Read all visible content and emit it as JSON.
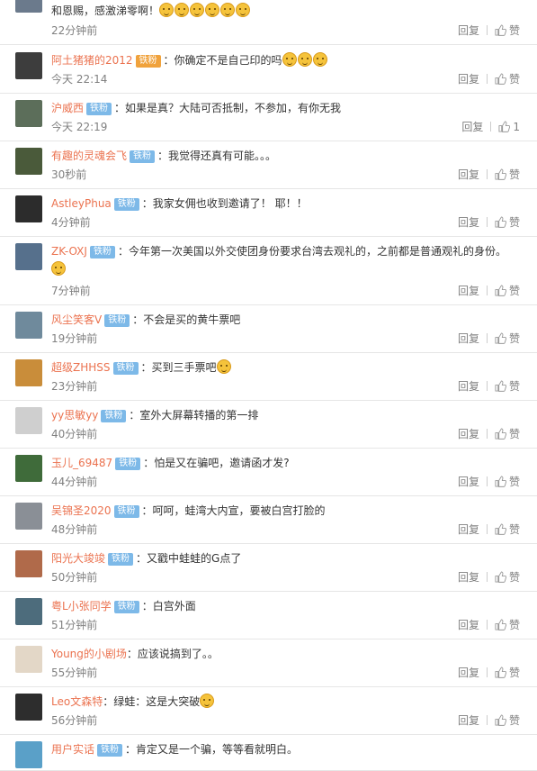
{
  "comments": [
    {
      "user": "",
      "badge": "",
      "text": "和恩赐，感激涕零啊！",
      "emojis": 6,
      "time": "22分钟前",
      "like": "赞",
      "reply": "回复"
    },
    {
      "user": "阿土猪猪的2012",
      "badge": "铁粉",
      "text": "：你确定不是自己印的吗",
      "emojis": 3,
      "time": "今天 22:14",
      "like": "赞",
      "reply": "回复"
    },
    {
      "user": "沪威西",
      "badge": "铁粉",
      "text": "：如果是真？大陆可否抵制，不参加，有你无我",
      "emojis": 0,
      "time": "今天 22:19",
      "like": "1",
      "reply": "回复"
    },
    {
      "user": "有趣的灵魂会飞",
      "badge": "铁粉",
      "text": "：我觉得还真有可能。。。",
      "emojis": 0,
      "time": "30秒前",
      "like": "赞",
      "reply": "回复"
    },
    {
      "user": "AstleyPhua",
      "badge": "铁粉",
      "text": "：我家女佣也收到邀请了！ 耶！！",
      "emojis": 0,
      "time": "4分钟前",
      "like": "赞",
      "reply": "回复"
    },
    {
      "user": "ZK-OXJ",
      "badge": "铁粉",
      "text": "：今年第一次美国以外交使团身份要求台湾去观礼的，之前都是普通观礼的身份。",
      "emojis": 1,
      "time": "7分钟前",
      "like": "赞",
      "reply": "回复"
    },
    {
      "user": "风尘笑客V",
      "badge": "铁粉",
      "text": "：不会是买的黄牛票吧",
      "emojis": 0,
      "time": "19分钟前",
      "like": "赞",
      "reply": "回复"
    },
    {
      "user": "超级ZHHSS",
      "badge": "铁粉",
      "text": "：买到三手票吧",
      "emojis": 1,
      "time": "23分钟前",
      "like": "赞",
      "reply": "回复"
    },
    {
      "user": "yy思敏yy",
      "badge": "铁粉",
      "text": "：室外大屏幕转播的第一排",
      "emojis": 0,
      "time": "40分钟前",
      "like": "赞",
      "reply": "回复"
    },
    {
      "user": "玉儿_69487",
      "badge": "铁粉",
      "text": "：怕是又在骗吧，邀请函才发?",
      "emojis": 0,
      "time": "44分钟前",
      "like": "赞",
      "reply": "回复"
    },
    {
      "user": "吴锦圣2020",
      "badge": "铁粉",
      "text": "：呵呵，蛙湾大内宣，要被白宫打脸的",
      "emojis": 0,
      "time": "48分钟前",
      "like": "赞",
      "reply": "回复"
    },
    {
      "user": "阳光大竣竣",
      "badge": "铁粉",
      "text": "：又戳中蛙蛙的G点了",
      "emojis": 0,
      "time": "50分钟前",
      "like": "赞",
      "reply": "回复"
    },
    {
      "user": "粤L小张同学",
      "badge": "铁粉",
      "text": "：白宫外面",
      "emojis": 0,
      "time": "51分钟前",
      "like": "赞",
      "reply": "回复"
    },
    {
      "user": "Young的小剧场",
      "badge": "",
      "text": "：应该说搞到了。。",
      "emojis": 0,
      "time": "55分钟前",
      "like": "赞",
      "reply": "回复"
    },
    {
      "user": "Leo文森特",
      "badge": "",
      "text": "：绿蛙：这是大突破",
      "emojis": 1,
      "time": "56分钟前",
      "like": "赞",
      "reply": "回复"
    },
    {
      "user": "用户实话",
      "badge": "铁粉",
      "text": "：肯定又是一个骗，等等看就明白。",
      "emojis": 0,
      "time": "",
      "like": "",
      "reply": ""
    }
  ],
  "colors": {
    "username": "#eb7350",
    "badge": "#7db9e8",
    "time": "#808080"
  }
}
